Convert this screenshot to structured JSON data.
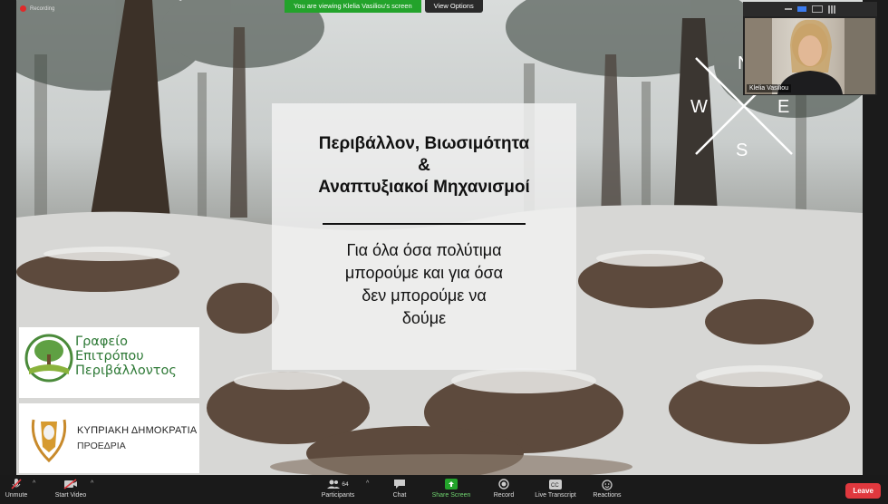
{
  "recording": {
    "label": "Recording"
  },
  "banner": {
    "message": "You are viewing Klelia Vasiliou's screen",
    "options": "View Options"
  },
  "slide": {
    "title_lines": [
      "Περιβάλλον, Βιωσιμότητα",
      "&",
      "Αναπτυξιακοί Μηχανισμοί"
    ],
    "subtitle_lines": [
      "Για όλα όσα πολύτιμα",
      "μπορούμε και για όσα",
      "δεν μπορούμε να",
      "δούμε"
    ],
    "compass": {
      "n": "N",
      "e": "E",
      "s": "S",
      "w": "W"
    },
    "logo1_lines": [
      "Γραφείο",
      "Επιτρόπου",
      "Περιβάλλοντος"
    ],
    "logo2_line1": "ΚΥΠΡΙΑΚΗ ΔΗΜΟΚΡΑΤΙΑ",
    "logo2_line2": "ΠΡΟΕΔΡΙΑ"
  },
  "video": {
    "participant_name": "Klelia Vasiliou"
  },
  "toolbar": {
    "unmute": "Unmute",
    "start_video": "Start Video",
    "participants": "Participants",
    "participants_count": "64",
    "chat": "Chat",
    "share_screen": "Share Screen",
    "record": "Record",
    "live_transcript": "Live Transcript",
    "reactions": "Reactions",
    "leave": "Leave"
  },
  "colors": {
    "share_green": "#23a32b",
    "leave_red": "#e0383e",
    "toolbar_bg": "#1a1a1a"
  }
}
